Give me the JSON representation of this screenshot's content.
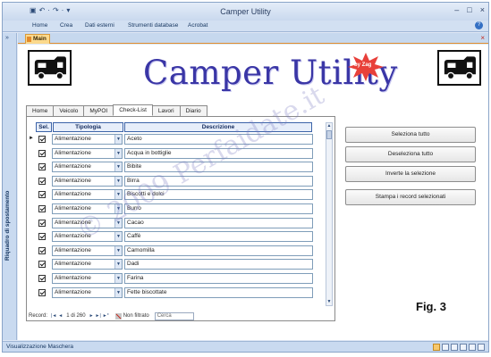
{
  "window": {
    "title": "Camper Utility",
    "controls": [
      "–",
      "□",
      "×"
    ]
  },
  "quick_access": [
    "▣",
    "↶",
    "·",
    "↷",
    "·",
    "▾"
  ],
  "ribbon": {
    "tabs": [
      "Home",
      "Crea",
      "Dati esterni",
      "Strumenti database",
      "Acrobat"
    ],
    "help": "?"
  },
  "nav_pane": {
    "toggle": "»",
    "label": "Riquadro di spostamento"
  },
  "document_tab": {
    "label": "Main",
    "close": "×"
  },
  "form": {
    "app_title": "Camper Utility",
    "badge_text": "by Zag",
    "tabs": [
      "Home",
      "Veicolo",
      "MyPOI",
      "Check-List",
      "Lavori",
      "Diario"
    ],
    "active_tab": "Check-List",
    "grid": {
      "headers": {
        "sel": "Sel.",
        "tipologia": "Tipologia",
        "descrizione": "Descrizione"
      },
      "rows": [
        {
          "tipologia": "Alimentazione",
          "descrizione": "Aceto"
        },
        {
          "tipologia": "Alimentazione",
          "descrizione": "Acqua in bottiglie"
        },
        {
          "tipologia": "Alimentazione",
          "descrizione": "Bibite"
        },
        {
          "tipologia": "Alimentazione",
          "descrizione": "Birra"
        },
        {
          "tipologia": "Alimentazione",
          "descrizione": "Biscotti e dolci"
        },
        {
          "tipologia": "Alimentazione",
          "descrizione": "Burro"
        },
        {
          "tipologia": "Alimentazione",
          "descrizione": "Cacao"
        },
        {
          "tipologia": "Alimentazione",
          "descrizione": "Caffè"
        },
        {
          "tipologia": "Alimentazione",
          "descrizione": "Camomilla"
        },
        {
          "tipologia": "Alimentazione",
          "descrizione": "Dadi"
        },
        {
          "tipologia": "Alimentazione",
          "descrizione": "Farina"
        },
        {
          "tipologia": "Alimentazione",
          "descrizione": "Fette biscottate"
        }
      ]
    },
    "record_nav": {
      "label": "Record:",
      "first": "|◄",
      "prev": "◄",
      "position": "1 di 260",
      "next": "►",
      "last": "►|",
      "new": "►*",
      "filter": "Non filtrato",
      "search": "Cerca"
    },
    "buttons": {
      "select_all": "Seleziona tutto",
      "deselect_all": "Deseleziona tutto",
      "invert": "Inverte la selezione",
      "print": "Stampa i record selezionati"
    },
    "figure_label": "Fig. 3",
    "watermark": "© 2009 Perfaidate.it"
  },
  "status_bar": {
    "text": "Visualizzazione Maschera"
  },
  "colors": {
    "title_accent": "#3a36a6",
    "badge": "#e8403a",
    "doc_tab": "#fbd98c"
  }
}
